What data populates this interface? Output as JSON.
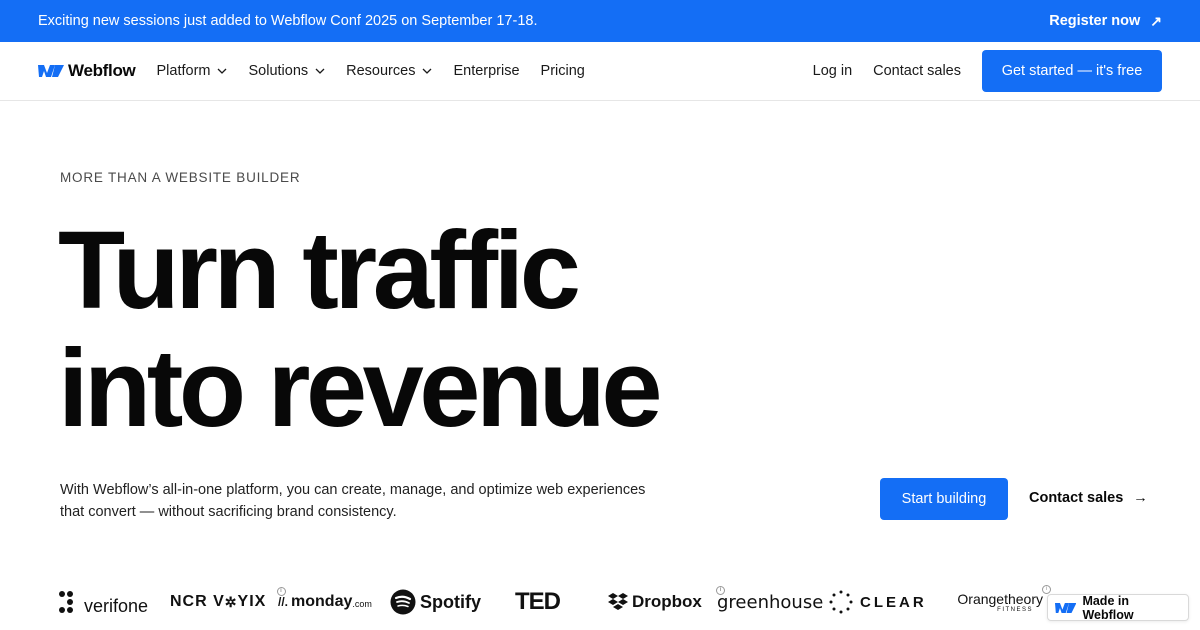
{
  "announcement": {
    "text": "Exciting new sessions just added to Webflow Conf 2025 on September 17-18.",
    "cta": "Register now"
  },
  "nav": {
    "brand": "Webflow",
    "items": [
      "Platform",
      "Solutions",
      "Resources",
      "Enterprise",
      "Pricing"
    ],
    "login": "Log in",
    "contact": "Contact sales",
    "cta": "Get started — it's free"
  },
  "hero": {
    "eyebrow": "MORE THAN A WEBSITE BUILDER",
    "headline_line1": "Turn traffic",
    "headline_line2": "into revenue",
    "subtext_line1": "With Webflow’s all-in-one platform, you can create, manage, and optimize web experiences",
    "subtext_line2": "that convert — without sacrificing brand consistency.",
    "primary_cta": "Start building",
    "secondary_cta": "Contact sales"
  },
  "logos": {
    "verifone": "verifone",
    "ncr_a": "NCR V",
    "ncr_b": "YIX",
    "monday": "monday",
    "monday_suffix": ".com",
    "spotify": "Spotify",
    "ted": "TED",
    "dropbox": "Dropbox",
    "greenhouse": "greenhouse",
    "clear": "CLEAR",
    "orangetheory": "Orangetheory",
    "orangetheory_sub": "FITNESS"
  },
  "badge": {
    "label": "Made in Webflow"
  },
  "colors": {
    "accent": "#146ef5",
    "text": "#080808"
  }
}
